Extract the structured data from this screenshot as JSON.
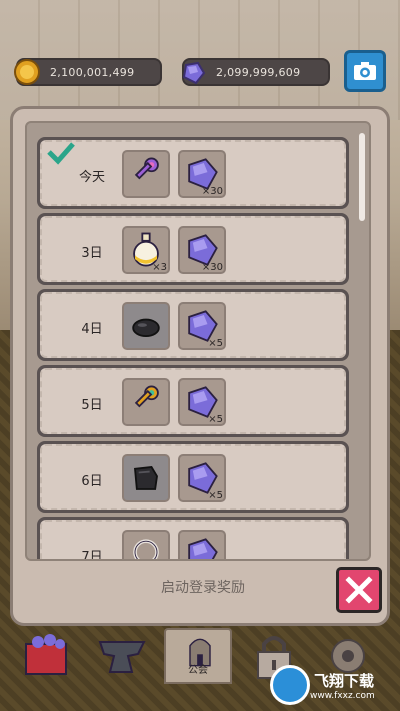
{
  "currency": {
    "gold": "2,100,001,499",
    "gems": "2,099,999,609"
  },
  "rewards": [
    {
      "day": "今天",
      "claimed": true,
      "item1": {
        "icon": "purple-key-icon",
        "qty": ""
      },
      "item2": {
        "icon": "purple-gem-icon",
        "qty": "×30"
      }
    },
    {
      "day": "3日",
      "claimed": false,
      "item1": {
        "icon": "potion-icon",
        "qty": "×3"
      },
      "item2": {
        "icon": "purple-gem-icon",
        "qty": "×30"
      }
    },
    {
      "day": "4日",
      "claimed": false,
      "item1": {
        "icon": "ore-rock-icon",
        "qty": ""
      },
      "item2": {
        "icon": "purple-gem-icon",
        "qty": "×5"
      }
    },
    {
      "day": "5日",
      "claimed": false,
      "item1": {
        "icon": "gold-key-icon",
        "qty": ""
      },
      "item2": {
        "icon": "purple-gem-icon",
        "qty": "×5"
      }
    },
    {
      "day": "6日",
      "claimed": false,
      "item1": {
        "icon": "dark-cloth-icon",
        "qty": ""
      },
      "item2": {
        "icon": "purple-gem-icon",
        "qty": "×5"
      }
    },
    {
      "day": "7日",
      "claimed": false,
      "item1": {
        "icon": "chain-ring-icon",
        "qty": ""
      },
      "item2": {
        "icon": "purple-gem-icon",
        "qty": ""
      }
    }
  ],
  "panel": {
    "footer_label": "启动登录奖励"
  },
  "nav": {
    "guild_label": "公会"
  },
  "watermark": {
    "title": "飞翔下载",
    "url": "www.fxxz.com"
  },
  "colors": {
    "gem": "#7b6cd9",
    "gold": "#e0a020",
    "close": "#e2466f",
    "camera": "#2f8fd0"
  }
}
